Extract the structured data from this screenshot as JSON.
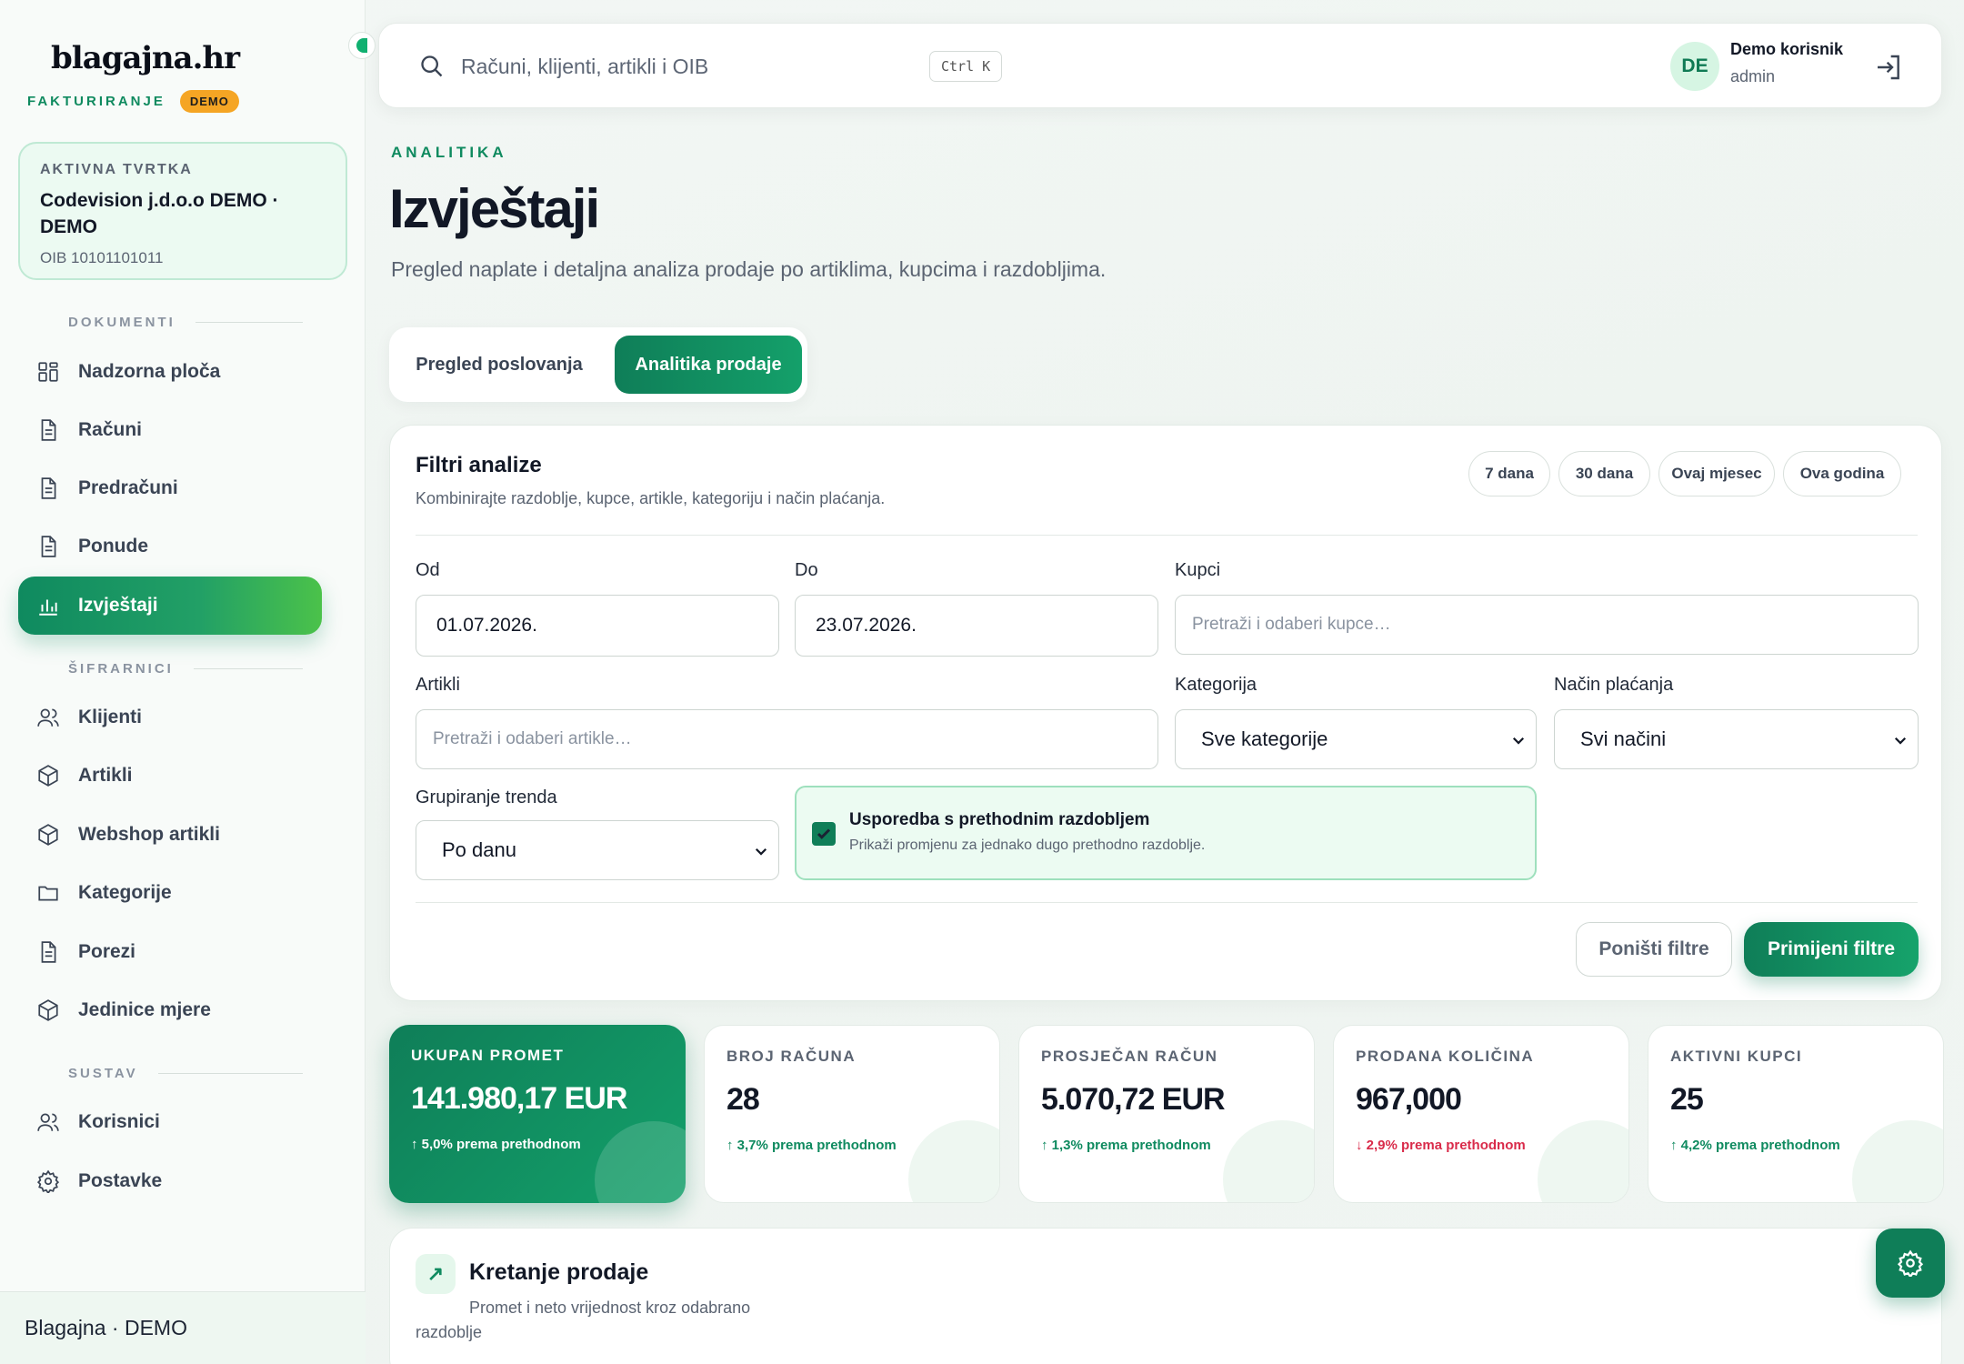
{
  "brand": {
    "logo": "blagajna.hr",
    "module": "FAKTURIRANJE",
    "badge": "DEMO"
  },
  "company": {
    "label": "AKTIVNA TVRTKA",
    "name": "Codevision j.d.o.o DEMO · DEMO",
    "oib": "OIB 10101101011"
  },
  "sidebar": {
    "sections": {
      "documents": "DOKUMENTI",
      "codes": "ŠIFRARNICI",
      "system": "SUSTAV"
    },
    "items": [
      {
        "label": "Nadzorna ploča",
        "icon": "grid-icon"
      },
      {
        "label": "Računi",
        "icon": "document-icon"
      },
      {
        "label": "Predračuni",
        "icon": "document-icon"
      },
      {
        "label": "Ponude",
        "icon": "document-icon"
      },
      {
        "label": "Izvještaji",
        "icon": "bar-chart-icon",
        "active": true
      },
      {
        "label": "Klijenti",
        "icon": "users-icon"
      },
      {
        "label": "Artikli",
        "icon": "box-icon"
      },
      {
        "label": "Webshop artikli",
        "icon": "box-icon"
      },
      {
        "label": "Kategorije",
        "icon": "folder-icon"
      },
      {
        "label": "Porezi",
        "icon": "document-icon"
      },
      {
        "label": "Jedinice mjere",
        "icon": "box-icon"
      },
      {
        "label": "Korisnici",
        "icon": "users-icon"
      },
      {
        "label": "Postavke",
        "icon": "gear-icon"
      }
    ],
    "footer": "Blagajna · DEMO"
  },
  "topbar": {
    "search_placeholder": "Računi, klijenti, artikli i OIB",
    "shortcut": "Ctrl K",
    "user": {
      "initials": "DE",
      "name": "Demo korisnik",
      "role": "admin"
    }
  },
  "page": {
    "eyebrow": "ANALITIKA",
    "title": "Izvještaji",
    "subtitle": "Pregled naplate i detaljna analiza prodaje po artiklima, kupcima i razdobljima."
  },
  "tabs": [
    {
      "label": "Pregled poslovanja"
    },
    {
      "label": "Analitika prodaje",
      "active": true
    }
  ],
  "filters": {
    "title": "Filtri analize",
    "subtitle": "Kombinirajte razdoblje, kupce, artikle, kategoriju i način plaćanja.",
    "presets": [
      "7 dana",
      "30 dana",
      "Ovaj mjesec",
      "Ova godina"
    ],
    "from_label": "Od",
    "from_value": "01.07.2026.",
    "to_label": "Do",
    "to_value": "23.07.2026.",
    "customers_label": "Kupci",
    "customers_placeholder": "Pretraži i odaberi kupce…",
    "articles_label": "Artikli",
    "articles_placeholder": "Pretraži i odaberi artikle…",
    "category_label": "Kategorija",
    "category_value": "Sve kategorije",
    "payment_label": "Način plaćanja",
    "payment_value": "Svi načini",
    "grouping_label": "Grupiranje trenda",
    "grouping_value": "Po danu",
    "compare_title": "Usporedba s prethodnim razdobljem",
    "compare_sub": "Prikaži promjenu za jednako dugo prethodno razdoblje.",
    "compare_checked": true,
    "reset_label": "Poništi filtre",
    "apply_label": "Primijeni filtre"
  },
  "kpis": [
    {
      "label": "UKUPAN PROMET",
      "value": "141.980,17 EUR",
      "delta": "↑ 5,0% prema prethodnom",
      "trend": "up"
    },
    {
      "label": "BROJ RAČUNA",
      "value": "28",
      "delta": "↑ 3,7% prema prethodnom",
      "trend": "up"
    },
    {
      "label": "PROSJEČAN RAČUN",
      "value": "5.070,72 EUR",
      "delta": "↑ 1,3% prema prethodnom",
      "trend": "up"
    },
    {
      "label": "PRODANA KOLIČINA",
      "value": "967,000",
      "delta": "↓ 2,9% prema prethodnom",
      "trend": "down"
    },
    {
      "label": "AKTIVNI KUPCI",
      "value": "25",
      "delta": "↑ 4,2% prema prethodnom",
      "trend": "up"
    }
  ],
  "trend": {
    "icon": "↗",
    "title": "Kretanje prodaje",
    "subtitle": "Promet i neto vrijednost kroz odabrano razdoblje"
  }
}
